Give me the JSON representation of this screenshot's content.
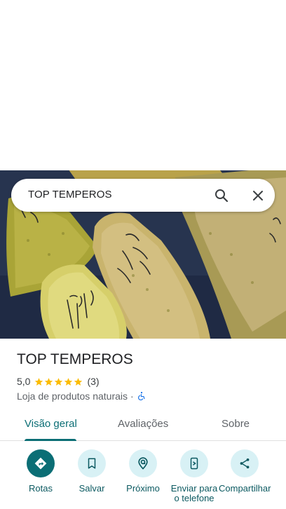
{
  "search": {
    "query": "TOP TEMPEROS"
  },
  "place": {
    "name": "TOP TEMPEROS",
    "rating": "5,0",
    "stars": 5,
    "review_count": "(3)",
    "category": "Loja de produtos naturais",
    "separator": "·"
  },
  "tabs": [
    {
      "label": "Visão geral",
      "active": true
    },
    {
      "label": "Avaliações",
      "active": false
    },
    {
      "label": "Sobre",
      "active": false
    }
  ],
  "actions": [
    {
      "label": "Rotas",
      "icon": "directions-icon"
    },
    {
      "label": "Salvar",
      "icon": "bookmark-icon"
    },
    {
      "label": "Próximo",
      "icon": "nearby-icon"
    },
    {
      "label": "Enviar para o telefone",
      "icon": "send-to-phone-icon"
    },
    {
      "label": "Compartilhar",
      "icon": "share-icon"
    }
  ],
  "colors": {
    "accent": "#0b6e75",
    "chip": "#d8f1f5",
    "star": "#fbbc04"
  }
}
